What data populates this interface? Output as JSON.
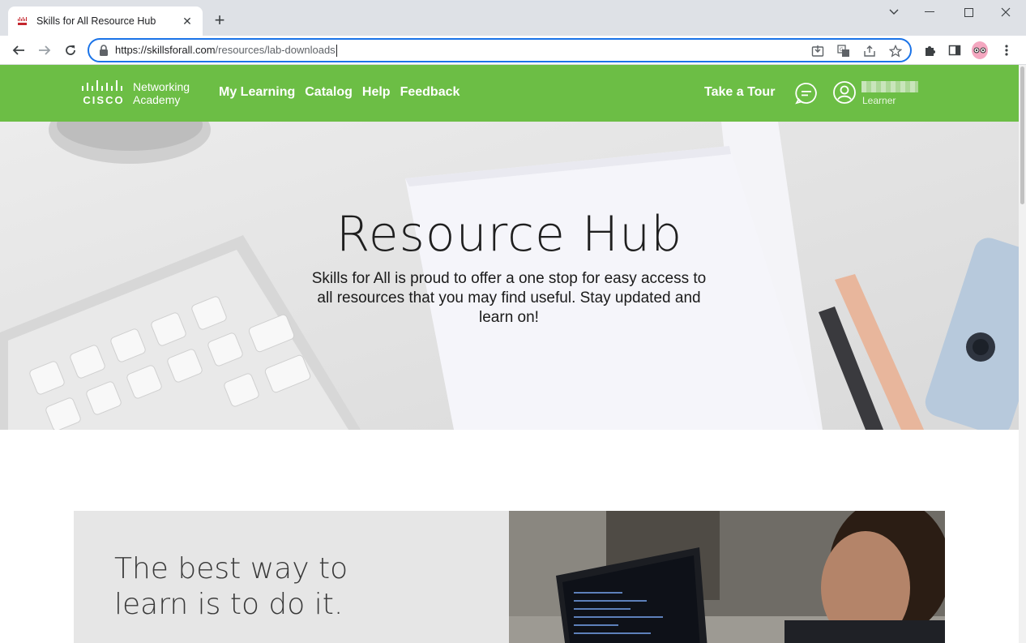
{
  "browser": {
    "tab_title": "Skills for All Resource Hub",
    "url_host": "https://skillsforall.com",
    "url_path": "/resources/lab-downloads"
  },
  "site": {
    "logo_brand": "CISCO",
    "logo_line1": "Networking",
    "logo_line2": "Academy",
    "nav": [
      "My Learning",
      "Catalog",
      "Help",
      "Feedback"
    ],
    "take_tour": "Take a Tour",
    "user_role": "Learner"
  },
  "hero": {
    "title": "Resource Hub",
    "description": "Skills for All is proud to offer a one stop for easy access to all resources that you may find useful. Stay updated and learn on!"
  },
  "card": {
    "heading_line1": "The best way to",
    "heading_line2": "learn is to do it."
  },
  "colors": {
    "header_green": "#6cbe45",
    "omnibox_focus": "#1a73e8"
  }
}
